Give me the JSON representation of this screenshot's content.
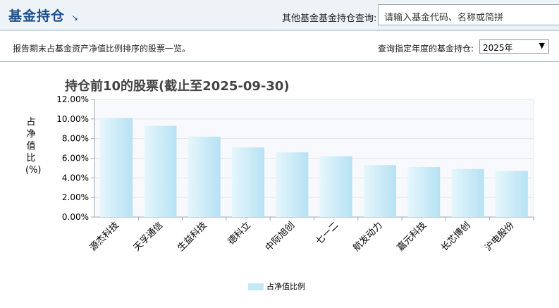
{
  "header": {
    "title": "基金持仓",
    "arrow": "↘",
    "query_label": "其他基金基金持仓查询:",
    "search_placeholder": "请输入基金代码、名称或简拼"
  },
  "subbar": {
    "description": "报告期末占基金资产净值比例排序的股票一览。",
    "year_label": "查询指定年度的基金持仓:",
    "year_value": "2025年"
  },
  "chart_data": {
    "type": "bar",
    "title": "持仓前10的股票(截止至2025-09-30)",
    "ylabel": "占净值比(%)",
    "xlabel": "",
    "categories": [
      "源杰科技",
      "天孚通信",
      "生益科技",
      "德科立",
      "中际旭创",
      "七一二",
      "航发动力",
      "嘉元科技",
      "长芯博创",
      "沪电股份"
    ],
    "series": [
      {
        "name": "占净值比例",
        "values": [
          10.1,
          9.3,
          8.2,
          7.1,
          6.6,
          6.2,
          5.3,
          5.1,
          4.9,
          4.7
        ]
      }
    ],
    "ylim": [
      0,
      12
    ],
    "yticks": [
      "0.00%",
      "2.00%",
      "4.00%",
      "6.00%",
      "8.00%",
      "10.00%",
      "12.00%"
    ],
    "grid": true,
    "legend_position": "bottom-center",
    "bar_color": "#c5e8f6"
  }
}
